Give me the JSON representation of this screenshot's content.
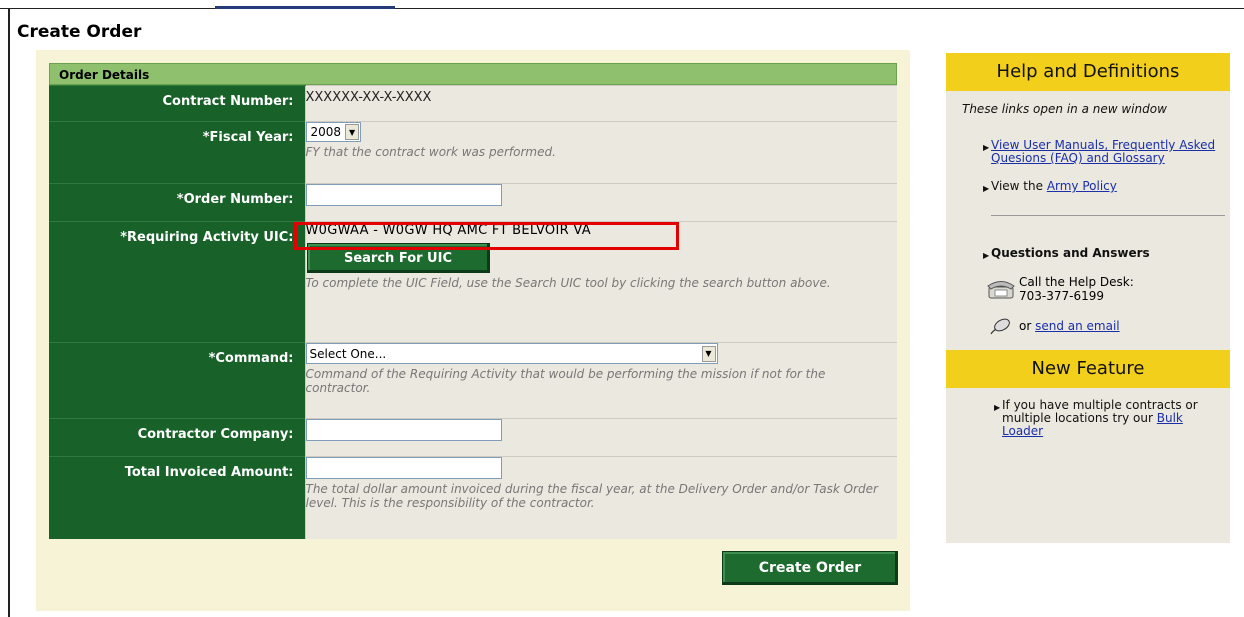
{
  "page": {
    "title": "Create Order"
  },
  "form": {
    "section_title": "Order Details",
    "contract": {
      "label": "Contract Number:",
      "value": "XXXXXX-XX-X-XXXX"
    },
    "fiscal_year": {
      "label": "*Fiscal Year:",
      "value": "2008",
      "help": "FY that the contract work was performed."
    },
    "order_number": {
      "label": "*Order Number:",
      "value": ""
    },
    "uic": {
      "label": "*Requiring Activity UIC:",
      "value": "W0GWAA - W0GW HQ AMC FT BELVOIR VA",
      "search_button": "Search For UIC",
      "help": "To complete the UIC Field, use the Search UIC tool by clicking the search button above."
    },
    "command": {
      "label": "*Command:",
      "value": "Select One...",
      "help": "Command of the Requiring Activity that would be performing the mission if not for the contractor."
    },
    "contractor_company": {
      "label": "Contractor Company:",
      "value": ""
    },
    "total_invoiced": {
      "label": "Total Invoiced Amount:",
      "value": "",
      "help": "The total dollar amount invoiced during the fiscal year, at the Delivery Order and/or Task Order level. This is the responsibility of the contractor."
    },
    "submit_button": "Create Order"
  },
  "sidebar": {
    "help_title": "Help and Definitions",
    "note": "These links open in a new window",
    "link_manuals": "View User Manuals, Frequently Asked Quesions (FAQ) and Glossary",
    "policy_prefix": "View the ",
    "policy_link": "Army Policy",
    "qa_title": "Questions and Answers",
    "helpdesk_label": "Call the Help Desk:",
    "helpdesk_phone": "703-377-6199",
    "email_prefix": "or ",
    "email_link": "send an email",
    "new_feature_title": "New Feature",
    "feature_text": "If you have multiple contracts or multiple locations try our ",
    "feature_link": "Bulk Loader"
  },
  "colors": {
    "label_bg": "#18622a",
    "header_bg": "#8fc06e",
    "sidebar_head": "#f2cf1a",
    "highlight": "#e30000"
  }
}
